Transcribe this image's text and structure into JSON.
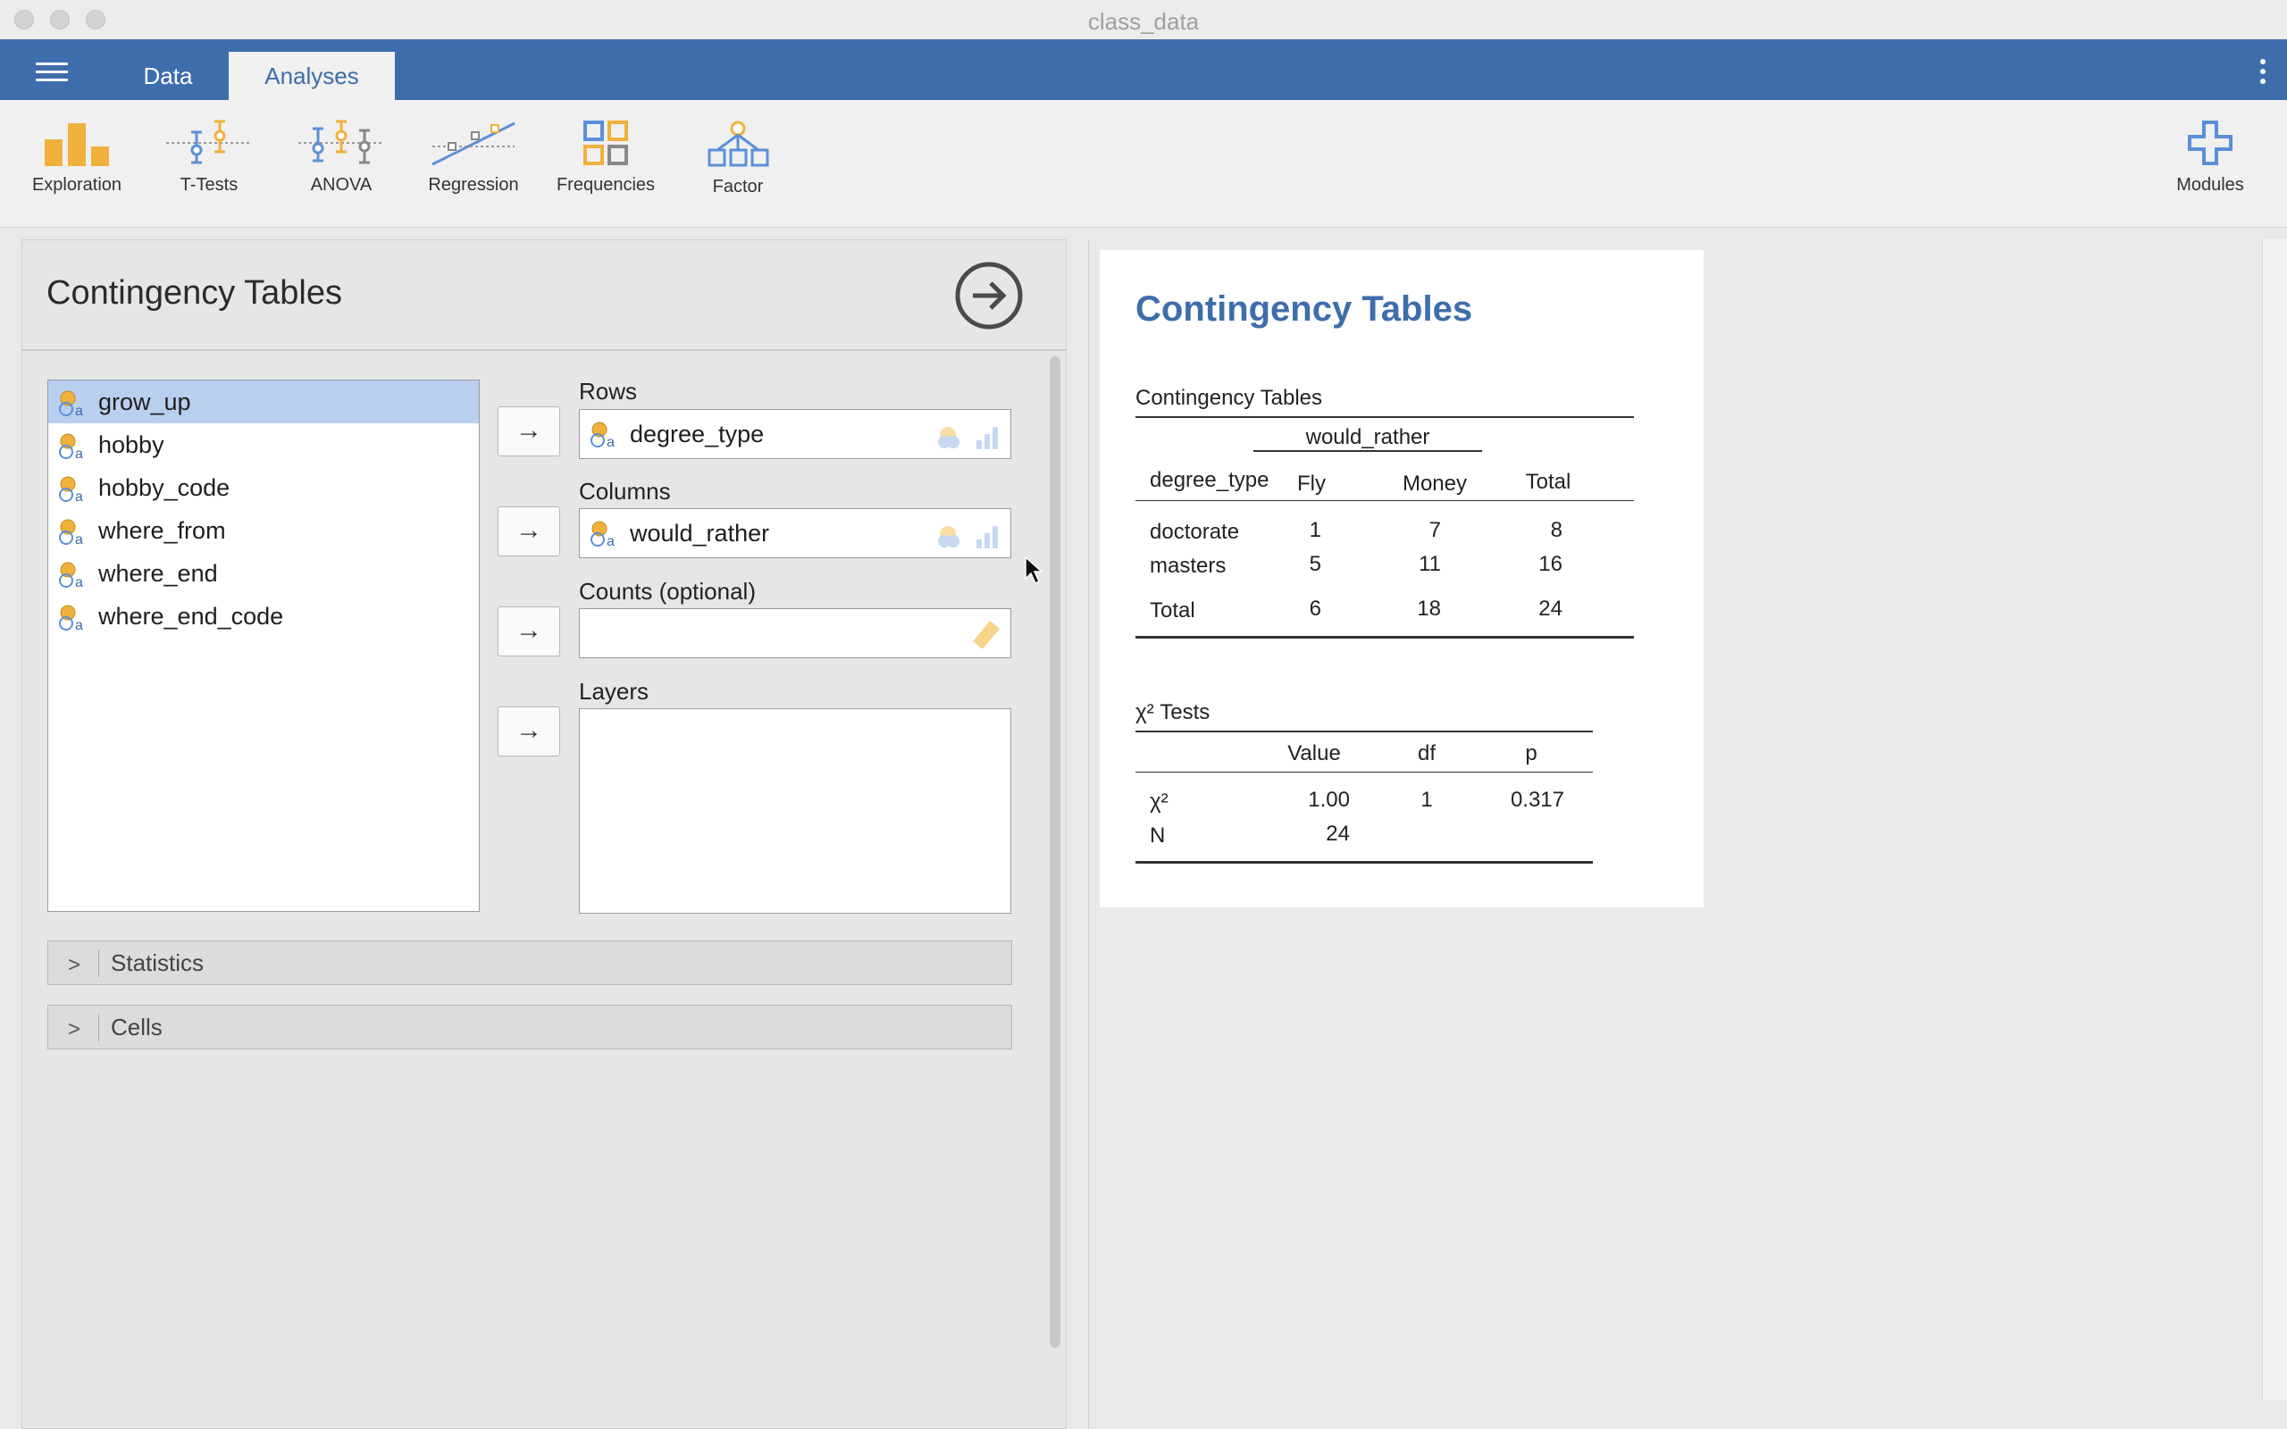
{
  "window": {
    "title": "class_data"
  },
  "tabs": {
    "data": "Data",
    "analyses": "Analyses"
  },
  "ribbon": {
    "exploration": "Exploration",
    "ttests": "T-Tests",
    "anova": "ANOVA",
    "regression": "Regression",
    "frequencies": "Frequencies",
    "factor": "Factor",
    "modules": "Modules"
  },
  "options": {
    "title": "Contingency Tables",
    "variables": [
      "grow_up",
      "hobby",
      "hobby_code",
      "where_from",
      "where_end",
      "where_end_code"
    ],
    "selected_variable": "grow_up",
    "rows_label": "Rows",
    "rows_value": "degree_type",
    "columns_label": "Columns",
    "columns_value": "would_rather",
    "counts_label": "Counts (optional)",
    "counts_value": "",
    "layers_label": "Layers",
    "statistics_label": "Statistics",
    "cells_label": "Cells",
    "arrow_glyph": "→"
  },
  "results": {
    "heading": "Contingency Tables",
    "ct": {
      "caption": "Contingency Tables",
      "group_header": "would_rather",
      "row_var": "degree_type",
      "columns": [
        "Fly",
        "Money",
        "Total"
      ],
      "rows": [
        {
          "label": "doctorate",
          "values": [
            "1",
            "7",
            "8"
          ]
        },
        {
          "label": "masters",
          "values": [
            "5",
            "11",
            "16"
          ]
        },
        {
          "label": "Total",
          "values": [
            "6",
            "18",
            "24"
          ]
        }
      ]
    },
    "chi": {
      "caption": "χ² Tests",
      "columns": [
        "Value",
        "df",
        "p"
      ],
      "rows": [
        {
          "label": "χ²",
          "values": [
            "1.00",
            "1",
            "0.317"
          ]
        },
        {
          "label": "N",
          "values": [
            "24",
            "",
            ""
          ]
        }
      ]
    }
  },
  "colors": {
    "accent": "#3e6dab",
    "selection": "#b9cff0",
    "icon_orange": "#f0b13c",
    "icon_blue": "#5b8fd9"
  }
}
